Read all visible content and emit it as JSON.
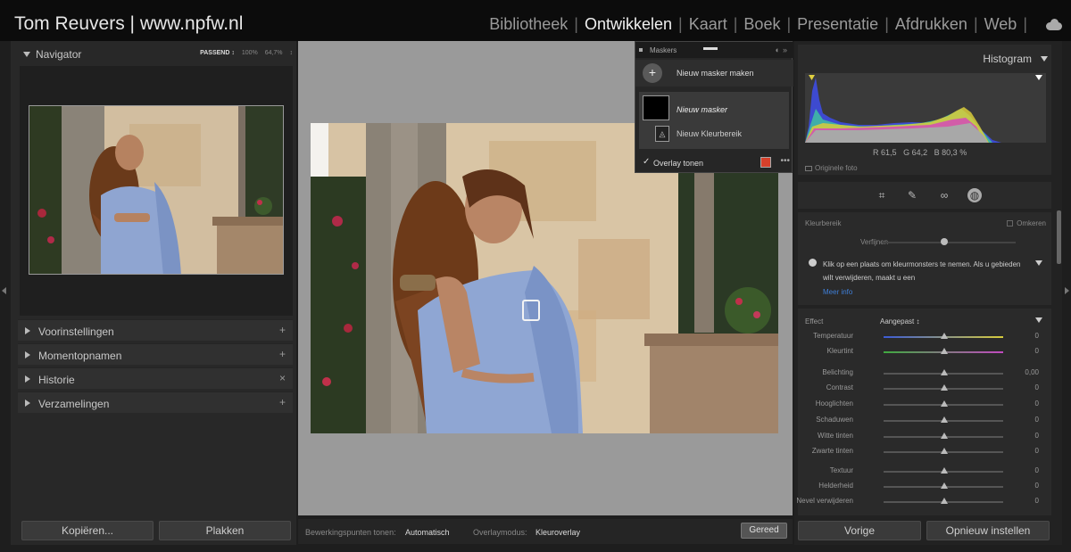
{
  "header": {
    "identity": "Tom Reuvers | www.npfw.nl",
    "modules": [
      {
        "label": "Bibliotheek",
        "active": false
      },
      {
        "label": "Ontwikkelen",
        "active": true
      },
      {
        "label": "Kaart",
        "active": false
      },
      {
        "label": "Boek",
        "active": false
      },
      {
        "label": "Presentatie",
        "active": false
      },
      {
        "label": "Afdrukken",
        "active": false
      },
      {
        "label": "Web",
        "active": false
      }
    ],
    "cloud_icon": "cloud-icon"
  },
  "navigator": {
    "title": "Navigator",
    "zoom": [
      "PASSEND ↕",
      "100%",
      "64,7%",
      "↕"
    ]
  },
  "left_sections": [
    {
      "label": "Voorinstellingen",
      "action": "+"
    },
    {
      "label": "Momentopnamen",
      "action": "+"
    },
    {
      "label": "Historie",
      "action": "×"
    },
    {
      "label": "Verzamelingen",
      "action": "+"
    }
  ],
  "left_buttons": {
    "copy": "Kopiëren...",
    "paste": "Plakken"
  },
  "masks_panel": {
    "title": "Maskers",
    "new_mask": "Nieuw masker maken",
    "mask_name": "Nieuw masker",
    "sub_mask": "Nieuw Kleurbereik",
    "overlay": "Overlay tonen",
    "overlay_color": "#d6402b"
  },
  "bottom_bar": {
    "points_label": "Bewerkingspunten tonen:",
    "points_value": "Automatisch",
    "overlay_label": "Overlaymodus:",
    "overlay_value": "Kleuroverlay",
    "done": "Gereed"
  },
  "histogram": {
    "title": "Histogram",
    "r_label": "R",
    "r_value": "61,5",
    "g_label": "G",
    "g_value": "64,2",
    "b_label": "B",
    "b_value": "80,3",
    "unit": "%",
    "original": "Originele foto"
  },
  "color_range": {
    "title": "Kleurbereik",
    "invert": "Omkeren",
    "refine": "Verfijnen",
    "info": "Klik op een plaats om kleurmonsters te nemen. Als u gebieden wilt verwijderen, maakt u een",
    "more_info": "Meer info"
  },
  "effect": {
    "label": "Effect",
    "mode": "Aangepast ↕",
    "sliders": [
      {
        "label": "Temperatuur",
        "value": "0"
      },
      {
        "label": "Kleurtint",
        "value": "0"
      },
      {
        "label": "Belichting",
        "value": "0,00"
      },
      {
        "label": "Contrast",
        "value": "0"
      },
      {
        "label": "Hooglichten",
        "value": "0"
      },
      {
        "label": "Schaduwen",
        "value": "0"
      },
      {
        "label": "Witte tinten",
        "value": "0"
      },
      {
        "label": "Zwarte tinten",
        "value": "0"
      },
      {
        "label": "Textuur",
        "value": "0"
      },
      {
        "label": "Helderheid",
        "value": "0"
      },
      {
        "label": "Nevel verwijderen",
        "value": "0"
      }
    ]
  },
  "right_buttons": {
    "previous": "Vorige",
    "reset": "Opnieuw instellen"
  }
}
